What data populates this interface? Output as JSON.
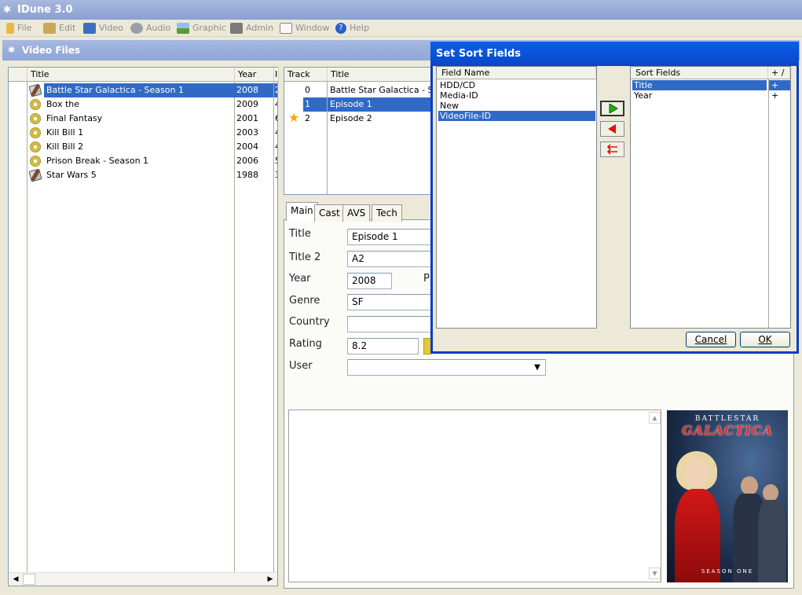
{
  "app": {
    "title": "IDune 3.0"
  },
  "menu": [
    {
      "label": "File",
      "icon": "folder-icon"
    },
    {
      "label": "Edit",
      "icon": "edit-icon"
    },
    {
      "label": "Video",
      "icon": "video-icon"
    },
    {
      "label": "Audio",
      "icon": "audio-icon"
    },
    {
      "label": "Graphic",
      "icon": "graphic-icon"
    },
    {
      "label": "Admin",
      "icon": "admin-icon"
    },
    {
      "label": "Window",
      "icon": "window-icon"
    },
    {
      "label": "Help",
      "icon": "help-icon"
    }
  ],
  "video_files": {
    "title": "Video Files",
    "columns": [
      "Title",
      "Year",
      "I"
    ],
    "rows": [
      {
        "title": "Battle Star Galactica - Season 1",
        "year": "2008",
        "extra": "2",
        "icon": "film-reel-icon",
        "selected": true
      },
      {
        "title": "Box the",
        "year": "2009",
        "extra": "4",
        "icon": "dvd-disc-icon"
      },
      {
        "title": "Final Fantasy",
        "year": "2001",
        "extra": "6",
        "icon": "dvd-disc-icon"
      },
      {
        "title": "Kill Bill 1",
        "year": "2003",
        "extra": "4",
        "icon": "dvd-disc-icon"
      },
      {
        "title": "Kill Bill 2",
        "year": "2004",
        "extra": "4",
        "icon": "dvd-disc-icon"
      },
      {
        "title": "Prison Break - Season 1",
        "year": "2006",
        "extra": "5",
        "icon": "dvd-disc-icon"
      },
      {
        "title": "Star Wars 5",
        "year": "1988",
        "extra": "3",
        "icon": "film-reel-icon"
      }
    ]
  },
  "tracks": {
    "columns": [
      "Track",
      "Title"
    ],
    "rows": [
      {
        "track": "0",
        "title": "Battle Star Galactica - Seas"
      },
      {
        "track": "1",
        "title": "Episode 1",
        "selected": true
      },
      {
        "track": "2",
        "title": "Episode 2",
        "starred": true
      }
    ]
  },
  "tabs": [
    "Main",
    "Cast",
    "AVS",
    "Tech"
  ],
  "form": {
    "title_label": "Title",
    "title_value": "Episode 1",
    "title2_label": "Title 2",
    "title2_value": "A2",
    "year_label": "Year",
    "year_value": "2008",
    "p_label": "P",
    "genre_label": "Genre",
    "genre_value": "SF",
    "country_label": "Country",
    "country_value": "",
    "rating_label": "Rating",
    "rating_value": "8.2",
    "user_label": "User",
    "user_value": ""
  },
  "poster": {
    "line1": "BATTLESTAR",
    "line2": "GALACTICA",
    "line3": "SEASON ONE"
  },
  "dialog": {
    "title": "Set Sort Fields",
    "field_header": "Field Name",
    "fields": [
      {
        "label": "HDD/CD"
      },
      {
        "label": "Media-ID"
      },
      {
        "label": "New"
      },
      {
        "label": "VideoFile-ID",
        "selected": true
      }
    ],
    "sort_header": "Sort Fields",
    "sort_dir_header": "+ / -",
    "sort_fields": [
      {
        "label": "Title",
        "dir": "+",
        "selected": true
      },
      {
        "label": "Year",
        "dir": "+"
      }
    ],
    "cancel_label": "Cancel",
    "ok_label": "OK"
  },
  "colors": {
    "selection": "#316ac5",
    "dialog_title": "#0a4fd8",
    "accent_green": "#22b000",
    "accent_red": "#e01010"
  }
}
